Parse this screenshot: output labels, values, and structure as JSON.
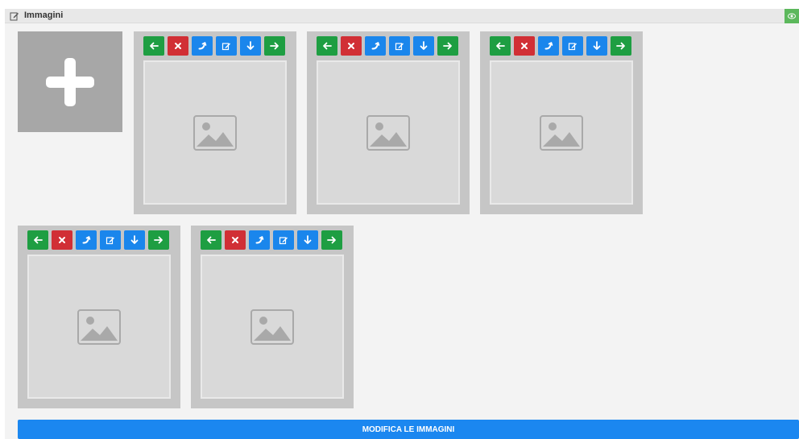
{
  "panel": {
    "title": "Immagini",
    "title_icon": "edit-icon",
    "visibility_icon": "eye-icon"
  },
  "add_tile": {
    "icon": "plus-icon"
  },
  "card_buttons": [
    {
      "name": "move-left",
      "icon": "arrow-left-icon",
      "color": "#1e9e42"
    },
    {
      "name": "delete",
      "icon": "close-icon",
      "color": "#d12f35"
    },
    {
      "name": "rotate",
      "icon": "rotate-icon",
      "color": "#1a86ec"
    },
    {
      "name": "edit",
      "icon": "edit-icon",
      "color": "#1a86ec"
    },
    {
      "name": "download",
      "icon": "arrow-down-icon",
      "color": "#1a86ec"
    },
    {
      "name": "move-right",
      "icon": "arrow-right-icon",
      "color": "#1e9e42"
    }
  ],
  "images": [
    {
      "id": "image-1"
    },
    {
      "id": "image-2"
    },
    {
      "id": "image-3"
    },
    {
      "id": "image-4"
    },
    {
      "id": "image-5"
    }
  ],
  "submit": {
    "label": "MODIFICA LE IMMAGINI"
  },
  "colors": {
    "accent_blue": "#1b87f0",
    "button_green": "#1e9e42",
    "button_red": "#d12f35",
    "eye_green": "#5cb85c",
    "card_bg": "#c6c6c6",
    "add_tile_bg": "#a7a7a7"
  }
}
